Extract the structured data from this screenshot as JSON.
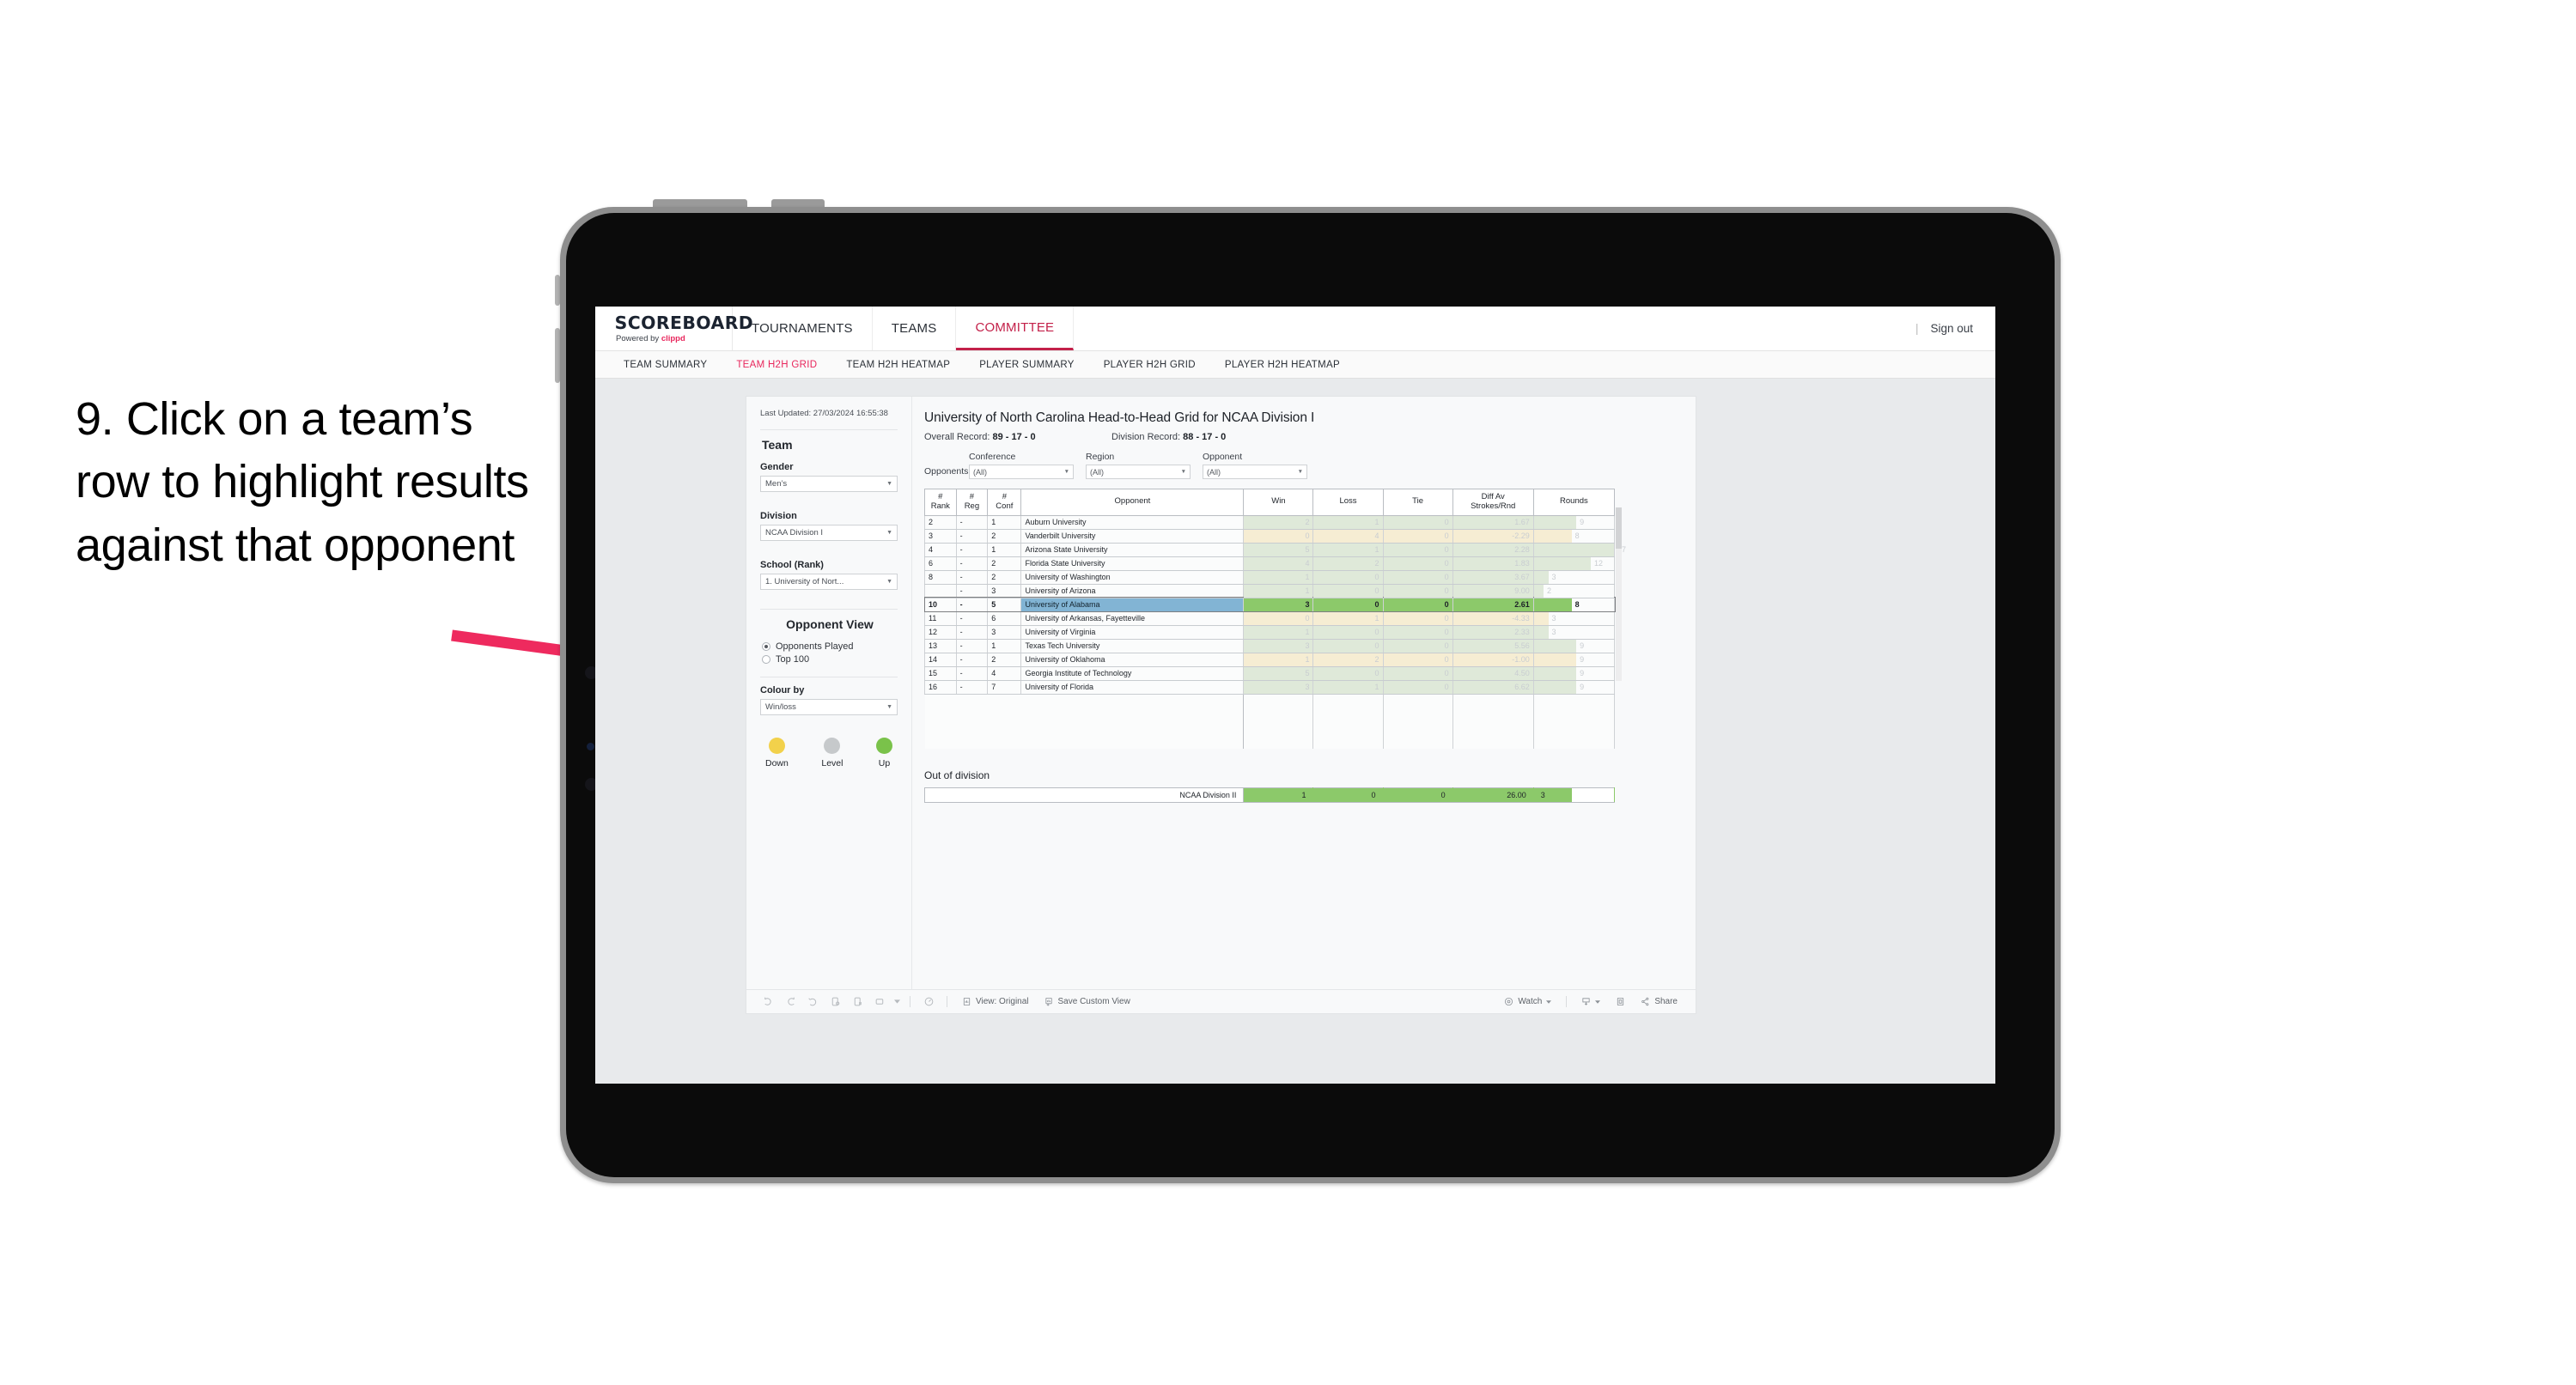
{
  "annotation": {
    "text": "9. Click on a team’s row to highlight results against that opponent",
    "arrow_color": "#ee2a5e"
  },
  "app": {
    "brand": {
      "title": "SCOREBOARD",
      "powered_prefix": "Powered by",
      "powered_brand": "clippd"
    },
    "top_nav": [
      {
        "label": "TOURNAMENTS",
        "active": false
      },
      {
        "label": "TEAMS",
        "active": false
      },
      {
        "label": "COMMITTEE",
        "active": true
      }
    ],
    "sign_out": "Sign out",
    "sub_nav": [
      {
        "label": "TEAM SUMMARY",
        "active": false
      },
      {
        "label": "TEAM H2H GRID",
        "active": true
      },
      {
        "label": "TEAM H2H HEATMAP",
        "active": false
      },
      {
        "label": "PLAYER SUMMARY",
        "active": false
      },
      {
        "label": "PLAYER H2H GRID",
        "active": false
      },
      {
        "label": "PLAYER H2H HEATMAP",
        "active": false
      }
    ]
  },
  "sidebar": {
    "last_updated": "Last Updated: 27/03/2024 16:55:38",
    "team_heading": "Team",
    "gender": {
      "label": "Gender",
      "value": "Men’s"
    },
    "division": {
      "label": "Division",
      "value": "NCAA Division I"
    },
    "school": {
      "label": "School (Rank)",
      "value": "1. University of Nort..."
    },
    "opponent_view": {
      "heading": "Opponent View",
      "options": [
        {
          "label": "Opponents Played",
          "selected": true
        },
        {
          "label": "Top 100",
          "selected": false
        }
      ]
    },
    "colour_by": {
      "label": "Colour by",
      "value": "Win/loss"
    },
    "legend": [
      {
        "label": "Down",
        "color": "#f2d14b"
      },
      {
        "label": "Level",
        "color": "#c6c9cb"
      },
      {
        "label": "Up",
        "color": "#7ac24a"
      }
    ]
  },
  "main": {
    "title": "University of North Carolina Head-to-Head Grid for NCAA Division I",
    "overall_record_label": "Overall Record:",
    "overall_record_value": "89 - 17 - 0",
    "division_record_label": "Division Record:",
    "division_record_value": "88 - 17 - 0",
    "opponents_label": "Opponents:",
    "filters": [
      {
        "caption": "Conference",
        "value": "(All)"
      },
      {
        "caption": "Region",
        "value": "(All)"
      },
      {
        "caption": "Opponent",
        "value": "(All)"
      }
    ]
  },
  "chart_data": {
    "type": "table",
    "title": "University of North Carolina Head-to-Head Grid for NCAA Division I",
    "columns": [
      "# Rank",
      "# Reg",
      "# Conf",
      "Opponent",
      "Win",
      "Loss",
      "Tie",
      "Diff Av Strokes/Rnd",
      "Rounds"
    ],
    "rounds_max": 17,
    "colors": {
      "win_green": "#dfe9d9",
      "loss_amber": "#f6edd3",
      "selected_green": "#8cc96a",
      "selected_opponent": "#82b4d4"
    },
    "rows": [
      {
        "rank": "2",
        "reg": "-",
        "conf": "1",
        "opponent": "Auburn University",
        "win": "2",
        "loss": "1",
        "tie": "0",
        "diff": "1.67",
        "rounds": 9,
        "tone": "up",
        "selected": false
      },
      {
        "rank": "3",
        "reg": "-",
        "conf": "2",
        "opponent": "Vanderbilt University",
        "win": "0",
        "loss": "4",
        "tie": "0",
        "diff": "-2.29",
        "rounds": 8,
        "tone": "down",
        "selected": false
      },
      {
        "rank": "4",
        "reg": "-",
        "conf": "1",
        "opponent": "Arizona State University",
        "win": "5",
        "loss": "1",
        "tie": "0",
        "diff": "2.28",
        "rounds": 17,
        "tone": "up",
        "selected": false
      },
      {
        "rank": "6",
        "reg": "-",
        "conf": "2",
        "opponent": "Florida State University",
        "win": "4",
        "loss": "2",
        "tie": "0",
        "diff": "1.83",
        "rounds": 12,
        "tone": "up",
        "selected": false
      },
      {
        "rank": "8",
        "reg": "-",
        "conf": "2",
        "opponent": "University of Washington",
        "win": "1",
        "loss": "0",
        "tie": "0",
        "diff": "3.67",
        "rounds": 3,
        "tone": "up",
        "selected": false
      },
      {
        "rank": "",
        "reg": "-",
        "conf": "3",
        "opponent": "University of Arizona",
        "win": "1",
        "loss": "0",
        "tie": "0",
        "diff": "9.00",
        "rounds": 2,
        "tone": "up",
        "selected": false
      },
      {
        "rank": "10",
        "reg": "-",
        "conf": "5",
        "opponent": "University of Alabama",
        "win": "3",
        "loss": "0",
        "tie": "0",
        "diff": "2.61",
        "rounds": 8,
        "tone": "up",
        "selected": true
      },
      {
        "rank": "11",
        "reg": "-",
        "conf": "6",
        "opponent": "University of Arkansas, Fayetteville",
        "win": "0",
        "loss": "1",
        "tie": "0",
        "diff": "-4.33",
        "rounds": 3,
        "tone": "down",
        "selected": false
      },
      {
        "rank": "12",
        "reg": "-",
        "conf": "3",
        "opponent": "University of Virginia",
        "win": "1",
        "loss": "0",
        "tie": "0",
        "diff": "2.33",
        "rounds": 3,
        "tone": "up",
        "selected": false
      },
      {
        "rank": "13",
        "reg": "-",
        "conf": "1",
        "opponent": "Texas Tech University",
        "win": "3",
        "loss": "0",
        "tie": "0",
        "diff": "5.56",
        "rounds": 9,
        "tone": "up",
        "selected": false
      },
      {
        "rank": "14",
        "reg": "-",
        "conf": "2",
        "opponent": "University of Oklahoma",
        "win": "1",
        "loss": "2",
        "tie": "0",
        "diff": "-1.00",
        "rounds": 9,
        "tone": "down",
        "selected": false
      },
      {
        "rank": "15",
        "reg": "-",
        "conf": "4",
        "opponent": "Georgia Institute of Technology",
        "win": "5",
        "loss": "0",
        "tie": "0",
        "diff": "4.50",
        "rounds": 9,
        "tone": "up",
        "selected": false
      },
      {
        "rank": "16",
        "reg": "-",
        "conf": "7",
        "opponent": "University of Florida",
        "win": "3",
        "loss": "1",
        "tie": "0",
        "diff": "6.62",
        "rounds": 9,
        "tone": "up",
        "selected": false
      }
    ],
    "out_of_division": {
      "heading": "Out of division",
      "row": {
        "label": "NCAA Division II",
        "win": "1",
        "loss": "0",
        "tie": "0",
        "diff": "26.00",
        "rounds": "3"
      }
    }
  },
  "toolbar": {
    "view_label": "View: Original",
    "save_label": "Save Custom View",
    "watch_label": "Watch",
    "share_label": "Share"
  }
}
